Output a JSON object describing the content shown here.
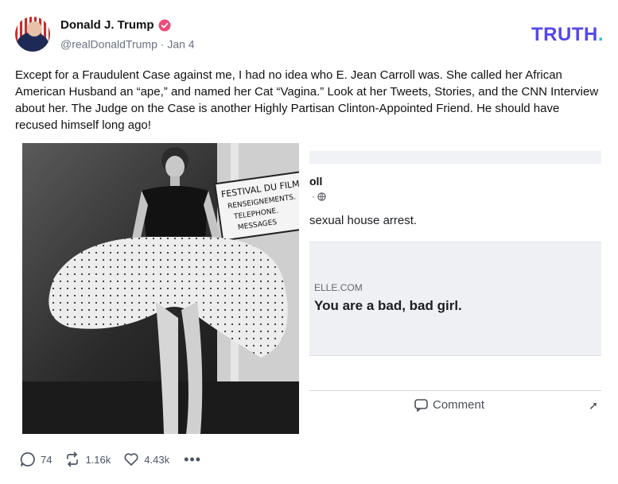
{
  "author": {
    "display_name": "Donald J. Trump",
    "handle": "@realDonaldTrump",
    "separator": "·",
    "date": "Jan 4",
    "verified_color": "#ee4c7b"
  },
  "brand": {
    "logo_text": "TRUTH",
    "logo_dot": ".",
    "color": "#5448ee",
    "dot_color": "#26c1c9"
  },
  "post": {
    "text": "Except for a Fraudulent Case against me, I had no idea who E. Jean Carroll was. She called her African American Husband an “ape,” and named her Cat “Vagina.” Look at her Tweets, Stories, and the CNN Interview about her. The Judge on the Case is another Highly Partisan Clinton-Appointed Friend. He should have recused himself long ago!"
  },
  "media": {
    "left_image": {
      "sign_line1": "FESTIVAL DU FILM",
      "sign_line2": "RENSEIGNEMENTS.",
      "sign_line3": "TELEPHONE.",
      "sign_line4": "MESSAGES"
    },
    "right_image": {
      "name_fragment": "oll",
      "meta_fragment": "· ",
      "text_fragment": "sexual house arrest.",
      "link_domain": "ELLE.COM",
      "link_headline": "You are a bad, bad girl.",
      "comment_label": "Comment"
    }
  },
  "actions": {
    "replies": "74",
    "retruths": "1.16k",
    "likes": "4.43k",
    "more": "•••"
  }
}
